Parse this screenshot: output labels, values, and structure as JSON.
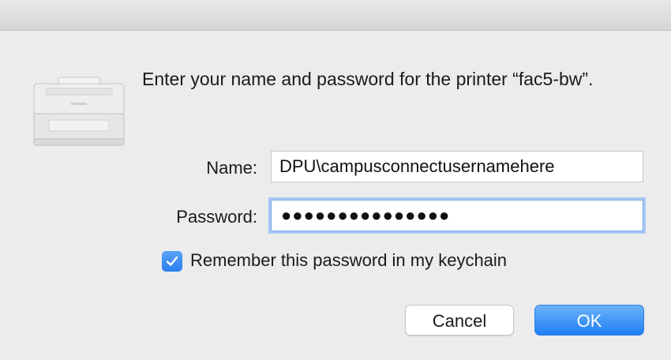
{
  "dialog": {
    "message": "Enter your name and password for the printer “fac5-bw”."
  },
  "form": {
    "name_label": "Name:",
    "name_value": "DPU\\campusconnectusernamehere",
    "password_label": "Password:",
    "password_dots": "●●●●●●●●●●●●●●●"
  },
  "remember": {
    "label": "Remember this password in my keychain",
    "checked": true
  },
  "buttons": {
    "cancel": "Cancel",
    "ok": "OK"
  },
  "icons": {
    "printer": "printer-icon",
    "checkbox": "checkmark-icon"
  },
  "colors": {
    "accent": "#2a7ef0",
    "focus_ring": "#a8c8f4"
  }
}
